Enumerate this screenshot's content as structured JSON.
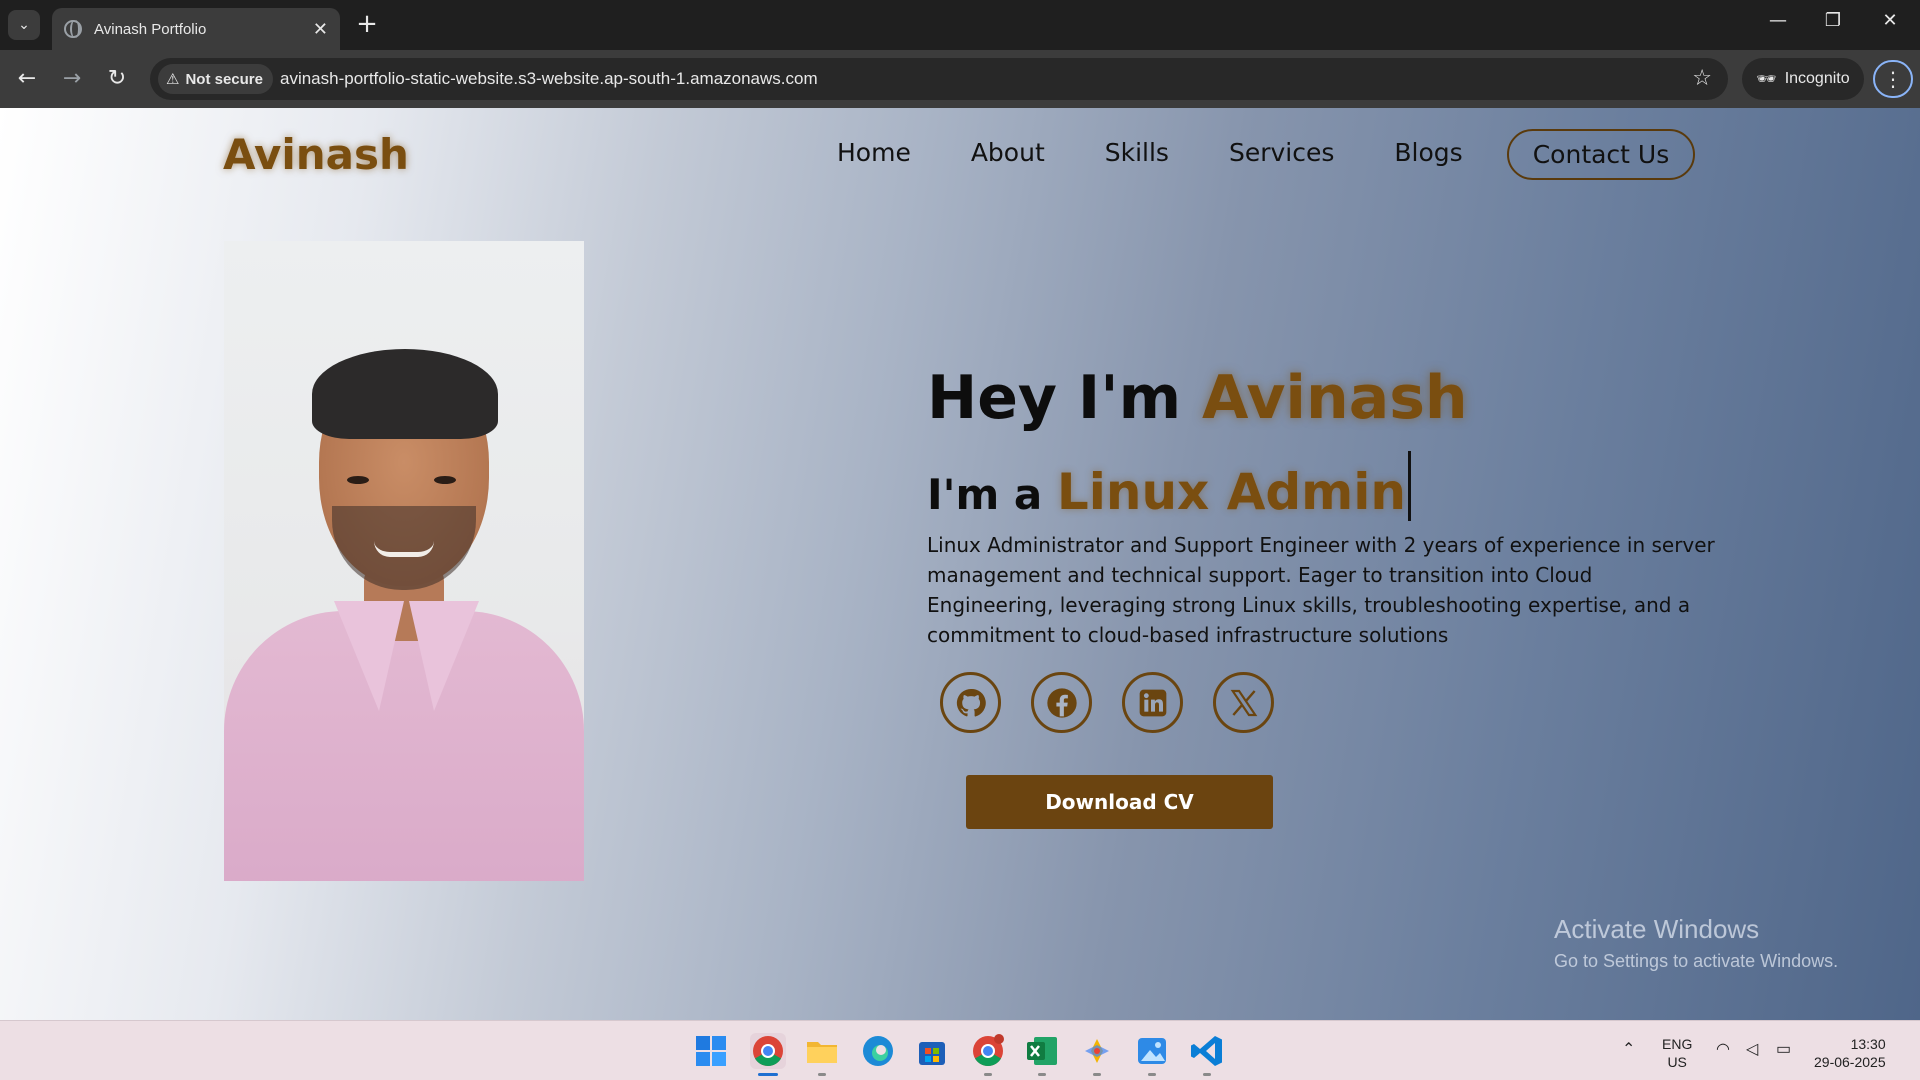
{
  "browser": {
    "tab_title": "Avinash Portfolio",
    "security_label": "Not secure",
    "url": "avinash-portfolio-static-website.s3-website.ap-south-1.amazonaws.com",
    "incognito_label": "Incognito"
  },
  "site": {
    "brand": "Avinash",
    "nav": [
      "Home",
      "About",
      "Skills",
      "Services",
      "Blogs"
    ],
    "contact_label": "Contact Us",
    "hero": {
      "greeting": "Hey I'm ",
      "name": "Avinash",
      "role_prefix": "I'm a ",
      "role": "Linux Admin",
      "bio": "Linux Administrator and Support Engineer with 2 years of experience in server management and technical support. Eager to transition into Cloud Engineering, leveraging strong Linux skills, troubleshooting expertise, and a commitment to cloud-based infrastructure solutions",
      "socials": [
        "github-icon",
        "facebook-icon",
        "linkedin-icon",
        "x-icon"
      ],
      "download_label": "Download CV"
    },
    "accent_color": "#7a4e10"
  },
  "watermark": {
    "line1": "Activate Windows",
    "line2": "Go to Settings to activate Windows."
  },
  "taskbar": {
    "lang_line1": "ENG",
    "lang_line2": "US",
    "time": "13:30",
    "date": "29-06-2025",
    "apps": [
      "windows-start-icon",
      "chrome-icon",
      "file-explorer-icon",
      "edge-icon",
      "store-icon",
      "chrome-profile-icon",
      "excel-icon",
      "gemini-icon",
      "photos-icon",
      "vscode-icon"
    ]
  }
}
